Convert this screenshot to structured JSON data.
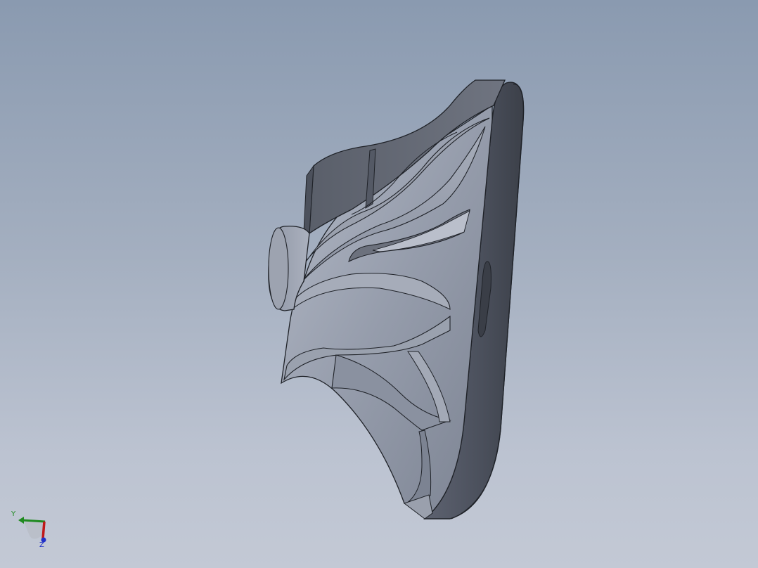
{
  "viewport": {
    "background_top": "#8a9ab0",
    "background_bottom": "#c3c9d5"
  },
  "model": {
    "part": "impeller",
    "shading": "shaded-with-edges",
    "body_color": "#7e8594",
    "edge_color": "#1f2228"
  },
  "triad": {
    "x_color": "#c01818",
    "y_color": "#1f8a1f",
    "z_color": "#2030c8",
    "y_label": "Y",
    "z_label": "Z"
  }
}
